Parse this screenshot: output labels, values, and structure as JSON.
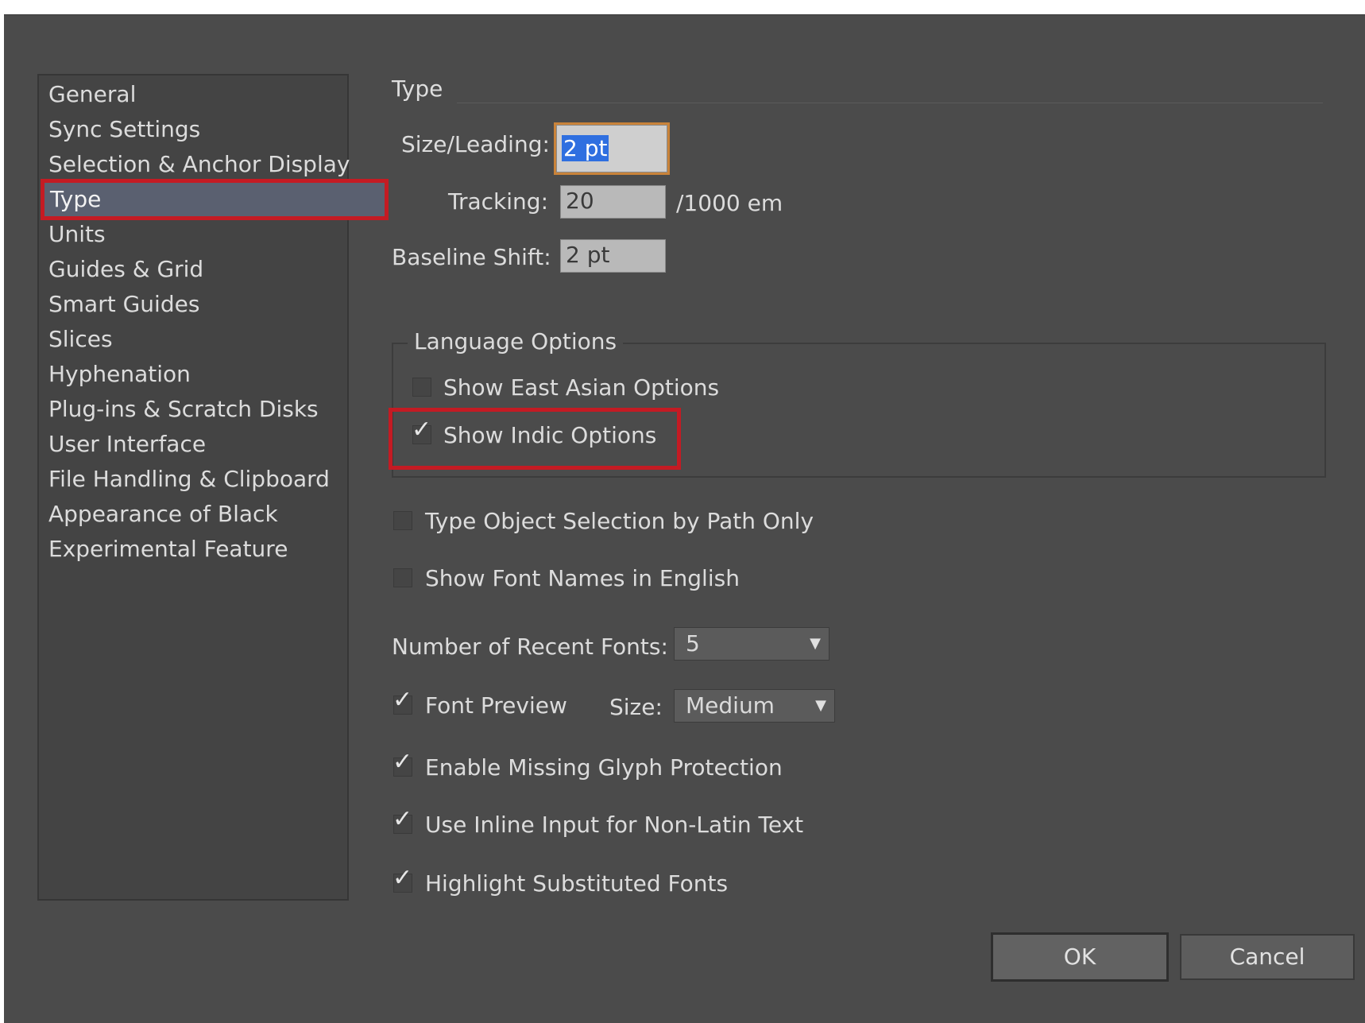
{
  "sidebar": {
    "items": [
      {
        "label": "General"
      },
      {
        "label": "Sync Settings"
      },
      {
        "label": "Selection & Anchor Display"
      },
      {
        "label": "Type"
      },
      {
        "label": "Units"
      },
      {
        "label": "Guides & Grid"
      },
      {
        "label": "Smart Guides"
      },
      {
        "label": "Slices"
      },
      {
        "label": "Hyphenation"
      },
      {
        "label": "Plug-ins & Scratch Disks"
      },
      {
        "label": "User Interface"
      },
      {
        "label": "File Handling & Clipboard"
      },
      {
        "label": "Appearance of Black"
      },
      {
        "label": "Experimental Feature"
      }
    ],
    "selected": "Type"
  },
  "main": {
    "title": "Type",
    "size_leading": {
      "label": "Size/Leading:",
      "value": "2 pt"
    },
    "tracking": {
      "label": "Tracking:",
      "value": "20",
      "unit": "/1000 em"
    },
    "baseline_shift": {
      "label": "Baseline Shift:",
      "value": "2 pt"
    },
    "language_options": {
      "legend": "Language Options",
      "east_asian": {
        "label": "Show East Asian Options",
        "checked": false
      },
      "indic": {
        "label": "Show Indic Options",
        "checked": true
      }
    },
    "type_object_selection": {
      "label": "Type Object Selection by Path Only",
      "checked": false
    },
    "font_names_english": {
      "label": "Show Font Names in English",
      "checked": false
    },
    "recent_fonts": {
      "label": "Number of Recent Fonts:",
      "value": "5"
    },
    "font_preview": {
      "label": "Font Preview",
      "checked": true,
      "size_label": "Size:",
      "size_value": "Medium"
    },
    "missing_glyph": {
      "label": "Enable Missing Glyph Protection",
      "checked": true
    },
    "inline_input": {
      "label": "Use Inline Input for Non-Latin Text",
      "checked": true
    },
    "highlight_substituted": {
      "label": "Highlight Substituted Fonts",
      "checked": true
    }
  },
  "buttons": {
    "ok": "OK",
    "cancel": "Cancel"
  },
  "colors": {
    "highlight": "#c41b23",
    "selection": "#2f6fe0",
    "dialog_bg": "#4b4b4b"
  }
}
